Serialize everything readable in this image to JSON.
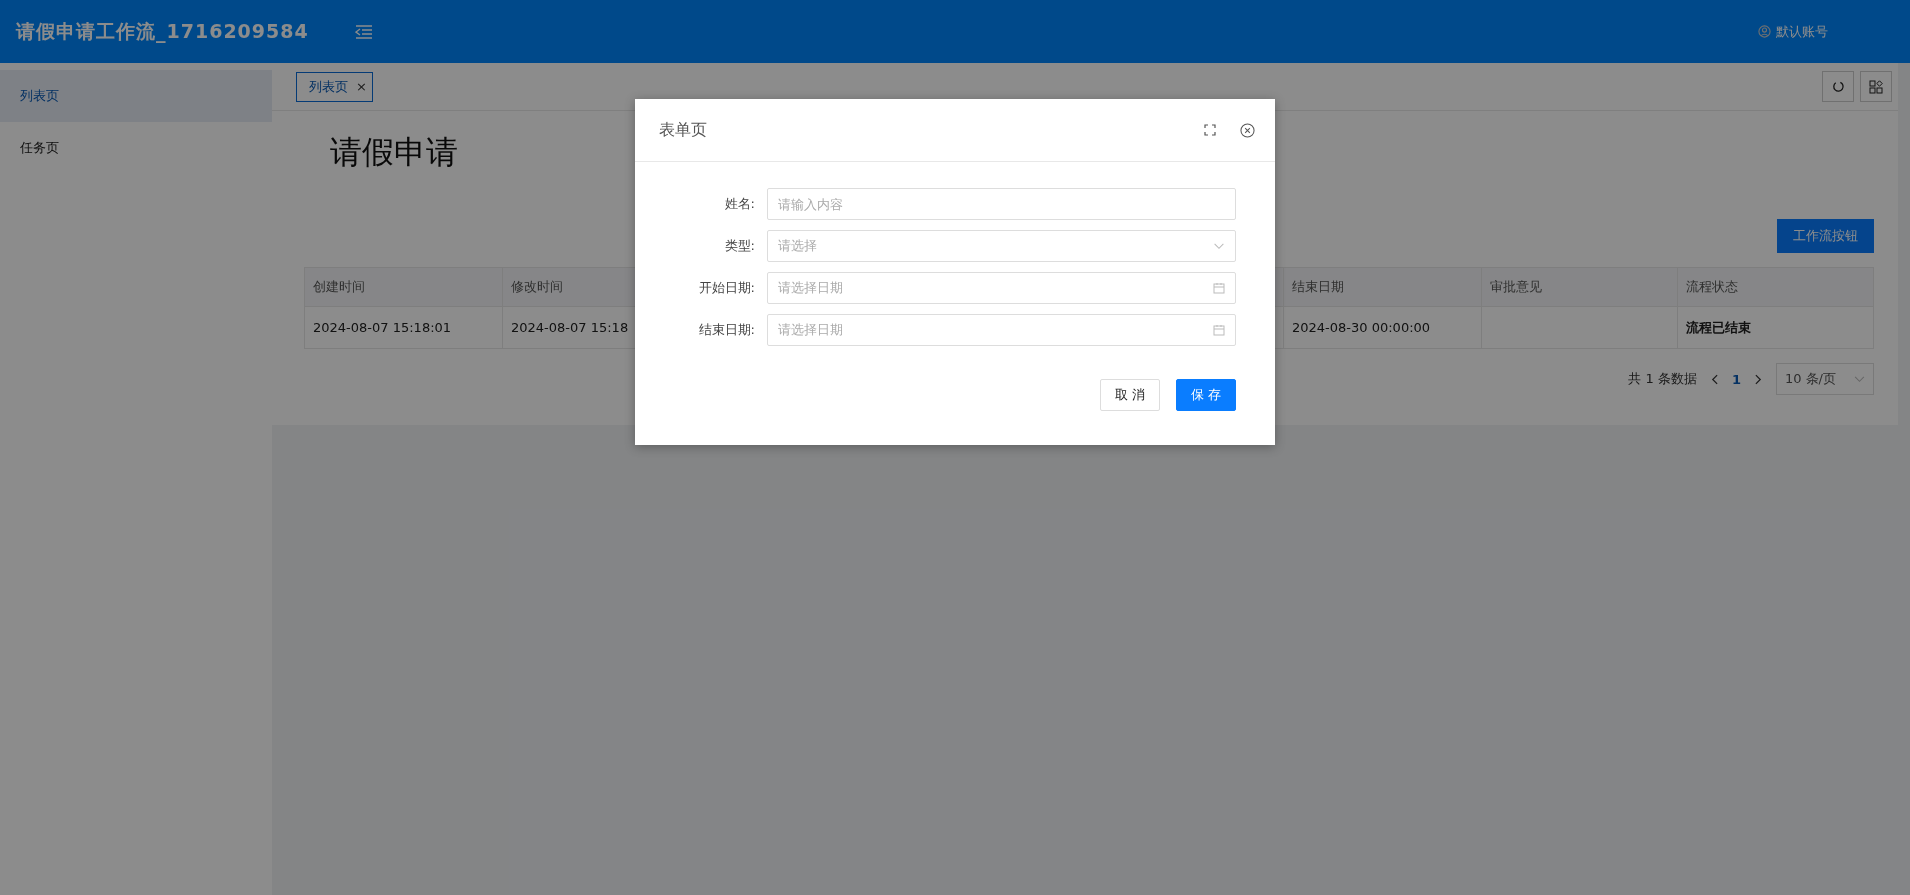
{
  "header": {
    "title": "请假申请工作流_1716209584",
    "account": "默认账号"
  },
  "sidebar": {
    "items": [
      {
        "label": "列表页",
        "selected": true
      },
      {
        "label": "任务页",
        "selected": false
      }
    ]
  },
  "tabs": [
    {
      "label": "列表页",
      "selected": true,
      "close": "×"
    }
  ],
  "page_title": "请假申请",
  "workflow_button": "工作流按钮",
  "table": {
    "columns": [
      "创建时间",
      "修改时间",
      "结束日期",
      "审批意见",
      "流程状态"
    ],
    "rows": [
      {
        "created": "2024-08-07 15:18:01",
        "modified": "2024-08-07 15:18",
        "end_date": "2024-08-30 00:00:00",
        "status": "流程已结束"
      }
    ]
  },
  "pagination": {
    "total": "共 1 条数据",
    "pages": [
      {
        "label": "1",
        "selected": true
      }
    ],
    "page_size": "10 条/页"
  },
  "dialog": {
    "title": "表单页",
    "fields": [
      {
        "kind": "text",
        "label": "姓名:",
        "placeholder": "请输入内容"
      },
      {
        "kind": "select",
        "label": "类型:",
        "placeholder": "请选择"
      },
      {
        "kind": "date",
        "label": "开始日期:",
        "placeholder": "请选择日期"
      },
      {
        "kind": "date",
        "label": "结束日期:",
        "placeholder": "请选择日期"
      }
    ],
    "cancel": "取 消",
    "save": "保 存"
  }
}
